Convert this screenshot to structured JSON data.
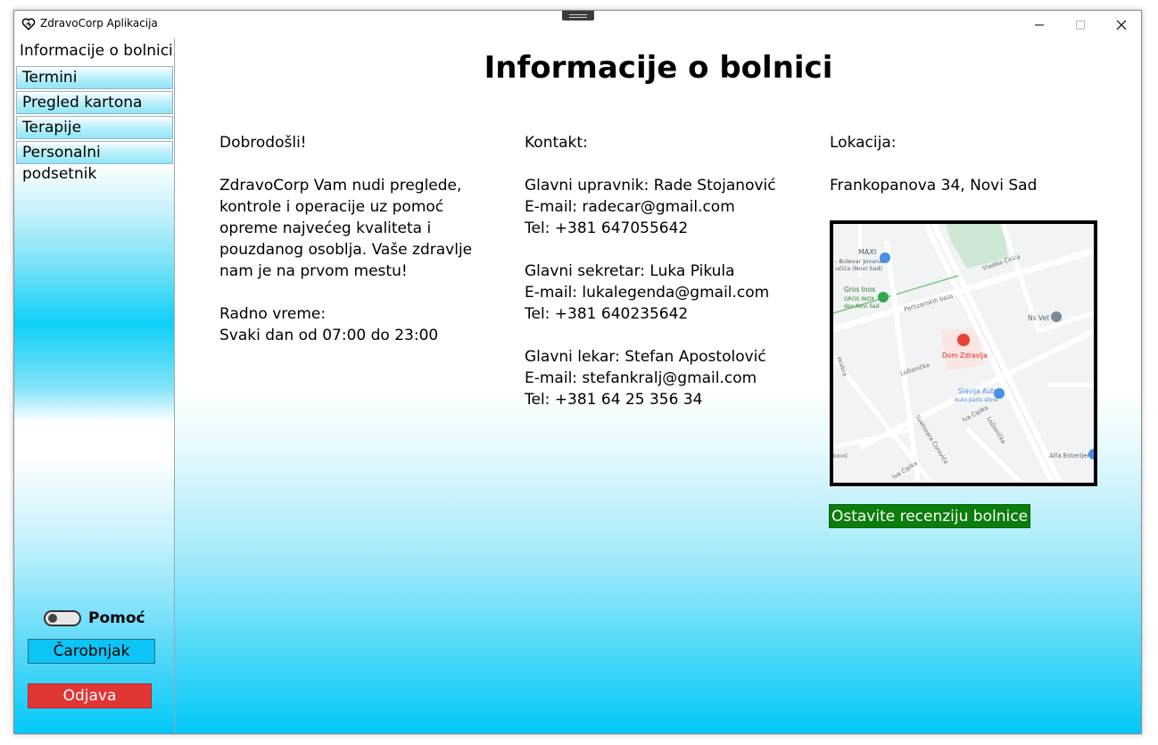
{
  "window": {
    "title": "ZdravoCorp Aplikacija",
    "controls": [
      "minimize-icon",
      "maximize-icon",
      "close-icon"
    ]
  },
  "sidebar": {
    "header": "Informacije o bolnici",
    "items": [
      {
        "label": "Termini"
      },
      {
        "label": "Pregled kartona"
      },
      {
        "label": "Terapije"
      },
      {
        "label": "Personalni podsetnik"
      }
    ],
    "help_toggle": {
      "label": "Pomoć",
      "on": false
    },
    "wizard_label": "Čarobnjak",
    "logout_label": "Odjava"
  },
  "main": {
    "title": "Informacije o bolnici",
    "welcome": {
      "heading": "Dobrodošli!",
      "text": "ZdravoCorp Vam nudi preglede,\nkontrole i operacije uz pomoć\nopreme najvećeg kvaliteta i\npouzdanog osoblja. Vaše zdravlje\nnam je na prvom mestu!",
      "hours_label": "Radno vreme:",
      "hours": "Svaki dan od 07:00 do 23:00"
    },
    "contact": {
      "heading": "Kontakt:",
      "people": [
        {
          "role": "Glavni upravnik: Rade Stojanović",
          "email": "E-mail: radecar@gmail.com",
          "tel": "Tel: +381 647055642"
        },
        {
          "role": "Glavni sekretar: Luka Pikula",
          "email": "E-mail: lukalegenda@gmail.com",
          "tel": "Tel: +381 640235642"
        },
        {
          "role": "Glavni lekar: Stefan Apostolović",
          "email": "E-mail: stefankralj@gmail.com",
          "tel": "Tel: +381 64 25 356 34"
        }
      ]
    },
    "location": {
      "heading": "Lokacija:",
      "address": "Frankopanova 34, Novi Sad",
      "map_labels": {
        "maxi": "MAXI",
        "maxi_sub1": "- Bulevar Jovana",
        "maxi_sub2": "učića (Novi Sad)",
        "gros": "Gros Inox",
        "gros_sub1": "GROS INOX",
        "gros_sub2": "doo Novi Sad",
        "vladike": "Vladike Ćirića",
        "partizanskih": "Partizanskih baza",
        "nsvet": "Ns Vet",
        "dom": "Dom Zdravlja",
        "lozionicka": "Ložionička",
        "slavija": "Slavija Auto",
        "slavija_sub": "Auto parts store",
        "hrabra": "Hrabra",
        "svetozara": "Svetozara Ćorovića",
        "iva1": "Iva Ćipika",
        "iva2": "Iva Ćipika",
        "lozionicka2": "Ložionička",
        "alfa": "Alfa Enterijer",
        "kovic": "ković"
      },
      "review_label": "Ostavite recenziju bolnice"
    }
  },
  "colors": {
    "accent": "#00c8f8",
    "logout": "#e23636",
    "review": "#0a7d0a",
    "wizard": "#0cc4f6"
  }
}
